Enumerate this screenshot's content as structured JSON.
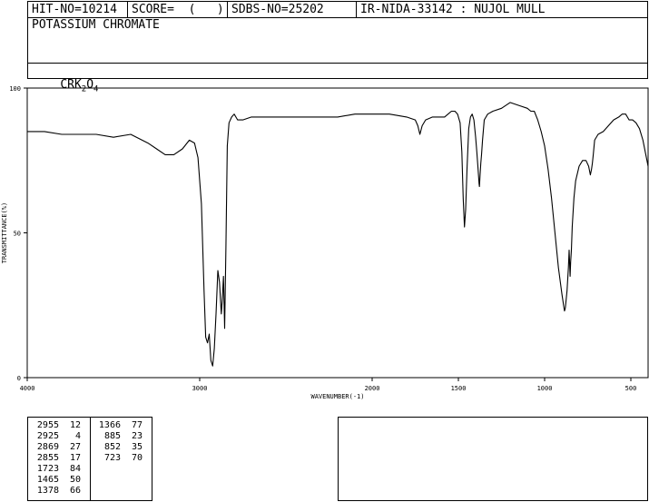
{
  "header": {
    "hit_no": "HIT-NO=10214",
    "score": "SCORE=  (   )",
    "sdbs_no": "SDBS-NO=25202",
    "ir_info": "IR-NIDA-33142 : NUJOL MULL",
    "compound_name": "POTASSIUM CHROMATE",
    "formula_main": "CRK",
    "formula_sub1": "2",
    "formula_mid": "O",
    "formula_sub2": "4"
  },
  "peak_table": {
    "col1": [
      {
        "wn": "2955",
        "t": "12"
      },
      {
        "wn": "2925",
        "t": "4"
      },
      {
        "wn": "2869",
        "t": "27"
      },
      {
        "wn": "2855",
        "t": "17"
      },
      {
        "wn": "1723",
        "t": "84"
      },
      {
        "wn": "1465",
        "t": "50"
      },
      {
        "wn": "1378",
        "t": "66"
      }
    ],
    "col2": [
      {
        "wn": "1366",
        "t": "77"
      },
      {
        "wn": "885",
        "t": "23"
      },
      {
        "wn": "852",
        "t": "35"
      },
      {
        "wn": "723",
        "t": "70"
      }
    ]
  },
  "chart_data": {
    "type": "line",
    "xlabel": "WAVENUMBER(-1)",
    "ylabel": "TRANSMITTANCE(%)",
    "xlim": [
      4000,
      400
    ],
    "ylim": [
      0,
      100
    ],
    "x_ticks": [
      4000,
      3000,
      2000,
      1500,
      1000,
      500
    ],
    "y_ticks": [
      0,
      50,
      100
    ],
    "x_tick_labels": [
      "4000",
      "3000",
      "2000",
      "1500",
      "1000",
      "500"
    ],
    "y_tick_labels": [
      "0",
      "50",
      "100"
    ],
    "series": [
      {
        "x": [
          4000,
          3900,
          3800,
          3700,
          3600,
          3500,
          3400,
          3300,
          3250,
          3200,
          3150,
          3100,
          3060,
          3030,
          3010,
          2990,
          2975,
          2965,
          2955,
          2945,
          2935,
          2925,
          2915,
          2905,
          2895,
          2885,
          2875,
          2869,
          2862,
          2855,
          2848,
          2840,
          2830,
          2815,
          2800,
          2780,
          2750,
          2700,
          2600,
          2500,
          2400,
          2300,
          2200,
          2100,
          2000,
          1900,
          1800,
          1750,
          1735,
          1723,
          1710,
          1690,
          1650,
          1600,
          1580,
          1560,
          1540,
          1520,
          1505,
          1490,
          1480,
          1472,
          1465,
          1458,
          1450,
          1440,
          1430,
          1420,
          1410,
          1400,
          1393,
          1386,
          1380,
          1378,
          1374,
          1370,
          1366,
          1360,
          1350,
          1330,
          1300,
          1250,
          1200,
          1150,
          1100,
          1080,
          1060,
          1040,
          1020,
          1000,
          980,
          960,
          940,
          920,
          900,
          890,
          885,
          880,
          870,
          862,
          858,
          855,
          852,
          849,
          845,
          840,
          830,
          820,
          800,
          780,
          760,
          745,
          735,
          728,
          723,
          718,
          710,
          690,
          660,
          630,
          600,
          570,
          550,
          530,
          510,
          490,
          470,
          450,
          430,
          400
        ],
        "y": [
          85,
          85,
          84,
          84,
          84,
          83,
          84,
          81,
          79,
          77,
          77,
          79,
          82,
          81,
          76,
          60,
          30,
          14,
          12,
          15,
          6,
          4,
          10,
          22,
          37,
          33,
          22,
          27,
          35,
          17,
          45,
          80,
          88,
          90,
          91,
          89,
          89,
          90,
          90,
          90,
          90,
          90,
          90,
          91,
          91,
          91,
          90,
          89,
          87,
          84,
          87,
          89,
          90,
          90,
          90,
          91,
          92,
          92,
          91,
          88,
          78,
          62,
          52,
          58,
          72,
          86,
          90,
          91,
          89,
          83,
          78,
          72,
          67,
          66,
          70,
          74,
          77,
          82,
          89,
          91,
          92,
          93,
          95,
          94,
          93,
          92,
          92,
          89,
          85,
          80,
          72,
          62,
          50,
          38,
          29,
          25,
          23,
          24,
          30,
          38,
          44,
          40,
          35,
          40,
          44,
          52,
          62,
          68,
          73,
          75,
          75,
          73,
          70,
          72,
          74,
          77,
          82,
          84,
          85,
          87,
          89,
          90,
          91,
          91,
          89,
          89,
          88,
          86,
          82,
          73
        ]
      }
    ]
  }
}
